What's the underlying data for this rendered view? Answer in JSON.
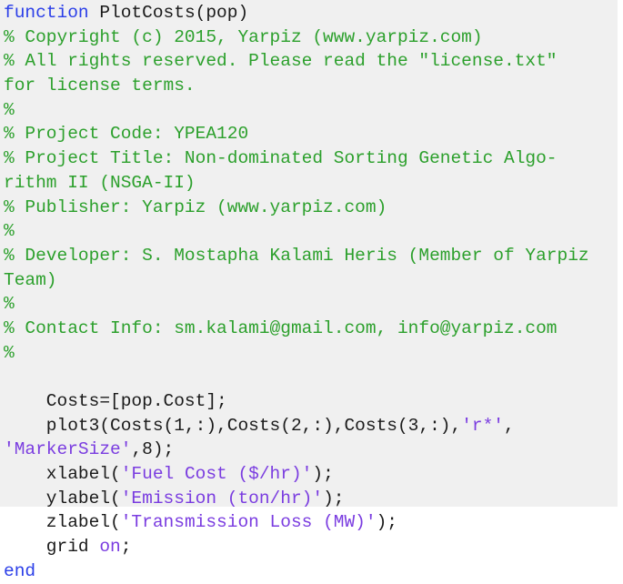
{
  "colors": {
    "background": "#f0f0f0",
    "keyword": "#2a3ee8",
    "comment": "#2ca02c",
    "string": "#7a3ce0",
    "text": "#1a1a1a"
  },
  "lines": [
    [
      {
        "t": "kw",
        "v": "function"
      },
      {
        "t": "tx",
        "v": " PlotCosts(pop)"
      }
    ],
    [
      {
        "t": "cm",
        "v": "% Copyright (c) 2015, Yarpiz (www.yarpiz.com)"
      }
    ],
    [
      {
        "t": "cm",
        "v": "% All rights reserved. Please read the \"license.txt\""
      }
    ],
    [
      {
        "t": "cm",
        "v": "for license terms."
      }
    ],
    [
      {
        "t": "cm",
        "v": "%"
      }
    ],
    [
      {
        "t": "cm",
        "v": "% Project Code: YPEA120"
      }
    ],
    [
      {
        "t": "cm",
        "v": "% Project Title: Non-dominated Sorting Genetic Algo-"
      }
    ],
    [
      {
        "t": "cm",
        "v": "rithm II (NSGA-II)"
      }
    ],
    [
      {
        "t": "cm",
        "v": "% Publisher: Yarpiz (www.yarpiz.com)"
      }
    ],
    [
      {
        "t": "cm",
        "v": "%"
      }
    ],
    [
      {
        "t": "cm",
        "v": "% Developer: S. Mostapha Kalami Heris (Member of Yarpiz"
      }
    ],
    [
      {
        "t": "cm",
        "v": "Team)"
      }
    ],
    [
      {
        "t": "cm",
        "v": "%"
      }
    ],
    [
      {
        "t": "cm",
        "v": "% Contact Info: sm.kalami@gmail.com, info@yarpiz.com"
      }
    ],
    [
      {
        "t": "cm",
        "v": "%"
      }
    ],
    [
      {
        "t": "tx",
        "v": ""
      }
    ],
    [
      {
        "t": "tx",
        "v": "    Costs=[pop.Cost];"
      }
    ],
    [
      {
        "t": "tx",
        "v": "    plot3(Costs(1,:),Costs(2,:),Costs(3,:),"
      },
      {
        "t": "st",
        "v": "'r*'"
      },
      {
        "t": "tx",
        "v": ","
      }
    ],
    [
      {
        "t": "st",
        "v": "'MarkerSize'"
      },
      {
        "t": "tx",
        "v": ",8);"
      }
    ],
    [
      {
        "t": "tx",
        "v": "    xlabel("
      },
      {
        "t": "st",
        "v": "'Fuel Cost ($/hr)'"
      },
      {
        "t": "tx",
        "v": ");"
      }
    ],
    [
      {
        "t": "tx",
        "v": "    ylabel("
      },
      {
        "t": "st",
        "v": "'Emission (ton/hr)'"
      },
      {
        "t": "tx",
        "v": ");"
      }
    ],
    [
      {
        "t": "tx",
        "v": "    zlabel("
      },
      {
        "t": "st",
        "v": "'Transmission Loss (MW)'"
      },
      {
        "t": "tx",
        "v": ");"
      }
    ],
    [
      {
        "t": "tx",
        "v": "    grid "
      },
      {
        "t": "st",
        "v": "on"
      },
      {
        "t": "tx",
        "v": ";"
      }
    ],
    [
      {
        "t": "kw",
        "v": "end"
      }
    ]
  ]
}
